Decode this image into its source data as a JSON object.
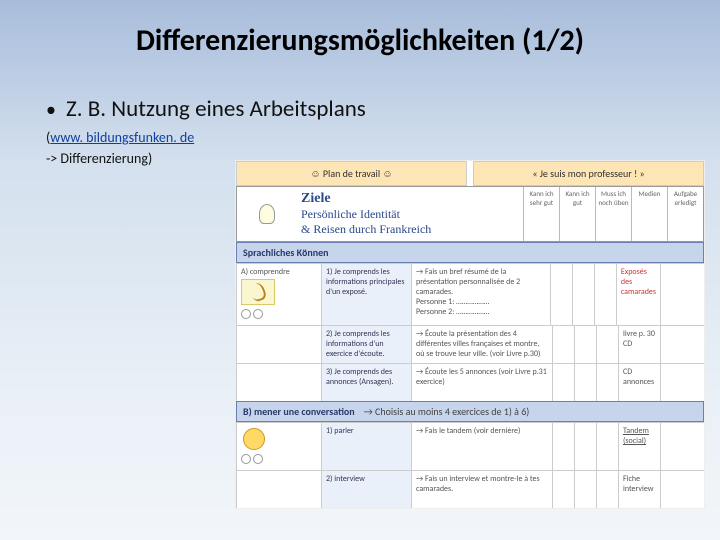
{
  "title": "Differenzierungsmöglichkeiten (1/2)",
  "bullet": "Z. B. Nutzung eines Arbeitsplans",
  "link_prefix": "(",
  "link_text": "www. bildungsfunken. de",
  "link_suffix": "",
  "subline2": "-> Differenzierung)",
  "embed": {
    "header_left": "☺  Plan de travail  ☺",
    "header_right": "« Je suis mon professeur ! »",
    "ziele_title": "Ziele",
    "ziele_line1": "Persönliche Identität",
    "ziele_line2": "&  Reisen durch Frankreich",
    "cols": {
      "c1": "Kann ich sehr gut",
      "c2": "Kann ich gut",
      "c3": "Muss ich noch üben",
      "c4": "Medien",
      "c5": "Aufgabe erledigt"
    },
    "section1": "Sprachliches Können",
    "rowA": {
      "label": "A) comprendre",
      "r1_c2": "1) Je comprends les informations principales d'un exposé.",
      "r1_c3_a": "→ Fais un bref résumé de la présentation personnalisée de 2 camarades.",
      "r1_c3_b": "Personne 1: ………………",
      "r1_c3_c": "Personne 2: ………………",
      "r1_m": "Exposés des camarades",
      "r2_c2": "2) Je comprends les informations d'un exercice d'écoute.",
      "r2_c3": "→ Écoute la présentation des 4 différentes villes françaises et montre, où se trouve leur ville. (voir Livre p.30)",
      "r2_m": "livre p. 30 CD",
      "r3_c2": "3) Je comprends des annonces (Ansagen).",
      "r3_c3": "→ Écoute les 5 annonces (voir Livre p.31 exercice)",
      "r3_m": "CD annonces"
    },
    "section2": "B) mener une conversation",
    "section2_sub": "→ Choisis au moins 4 exercices de 1) à 6)",
    "rowB": {
      "r1_label": "1) parler",
      "r1_c3": "→ Fais le tandem (voir dernière)",
      "r1_m": "Tandem (social)",
      "r2_label": "2) interview",
      "r2_c3": "→ Fais un interview et montre-le à tes camarades.",
      "r2_m": "Fiche interview"
    }
  }
}
